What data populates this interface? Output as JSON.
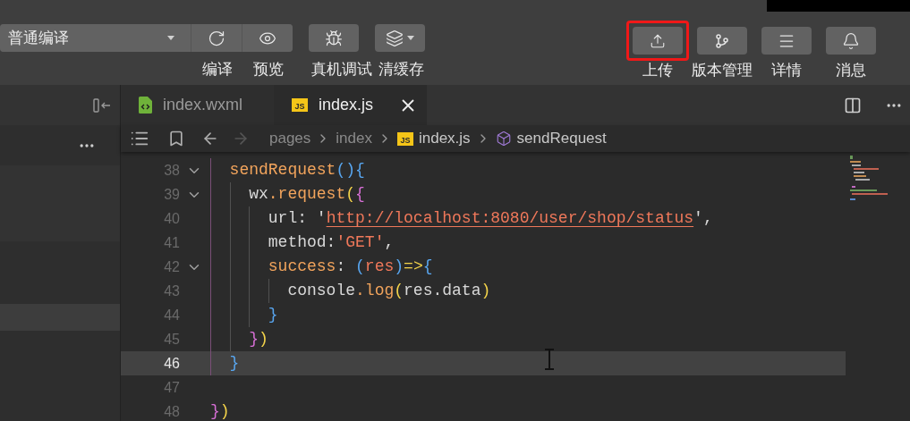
{
  "toolbar": {
    "compile_mode": {
      "value": "普通编译"
    },
    "left_buttons": [
      {
        "kind": "refresh",
        "label": "编译",
        "has_menu": false
      },
      {
        "kind": "eye",
        "label": "预览",
        "has_menu": false
      },
      {
        "kind": "bug",
        "label": "真机调试",
        "has_menu": false
      },
      {
        "kind": "layers",
        "label": "清缓存",
        "has_menu": true
      }
    ],
    "right_buttons": [
      {
        "kind": "upload",
        "label": "上传",
        "highlighted": true
      },
      {
        "kind": "branch",
        "label": "版本管理",
        "highlighted": false
      },
      {
        "kind": "menu",
        "label": "详情",
        "highlighted": false
      },
      {
        "kind": "bell",
        "label": "消息",
        "highlighted": false
      }
    ]
  },
  "editor_tabs": [
    {
      "label": "index.wxml",
      "kind": "wxml",
      "selected": false
    },
    {
      "label": "index.js",
      "kind": "js",
      "badge": "JS",
      "selected": true
    }
  ],
  "breadcrumb": [
    {
      "text": "pages",
      "kind": "folder"
    },
    {
      "text": "index",
      "kind": "folder"
    },
    {
      "text": "index.js",
      "kind": "js",
      "badge": "JS"
    },
    {
      "text": "sendRequest",
      "kind": "method"
    }
  ],
  "code_lines": [
    {
      "number": "38",
      "foldable": true,
      "current": false,
      "tokens": [
        {
          "text": "  sendRequest",
          "kind": "func"
        },
        {
          "text": "()",
          "kind": "b3"
        },
        {
          "text": "{",
          "kind": "b3"
        }
      ]
    },
    {
      "number": "39",
      "foldable": true,
      "current": false,
      "tokens": [
        {
          "text": "    wx",
          "kind": "text"
        },
        {
          "text": ".request",
          "kind": "func"
        },
        {
          "text": "(",
          "kind": "b1"
        },
        {
          "text": "{",
          "kind": "b2"
        }
      ]
    },
    {
      "number": "40",
      "foldable": false,
      "current": false,
      "tokens": [
        {
          "text": "      url: '",
          "kind": "text"
        },
        {
          "text": "http://localhost:8080/user/shop/status",
          "kind": "link"
        },
        {
          "text": "',",
          "kind": "text"
        }
      ]
    },
    {
      "number": "41",
      "foldable": false,
      "current": false,
      "tokens": [
        {
          "text": "      method:",
          "kind": "text"
        },
        {
          "text": "'GET'",
          "kind": "str"
        },
        {
          "text": ",",
          "kind": "text"
        }
      ]
    },
    {
      "number": "42",
      "foldable": true,
      "current": false,
      "tokens": [
        {
          "text": "      success",
          "kind": "func"
        },
        {
          "text": ": ",
          "kind": "text"
        },
        {
          "text": "(",
          "kind": "b3"
        },
        {
          "text": "res",
          "kind": "param"
        },
        {
          "text": ")",
          "kind": "b3"
        },
        {
          "text": "=>",
          "kind": "b1"
        },
        {
          "text": "{",
          "kind": "b3"
        }
      ]
    },
    {
      "number": "43",
      "foldable": false,
      "current": false,
      "tokens": [
        {
          "text": "        console",
          "kind": "text"
        },
        {
          "text": ".log",
          "kind": "func"
        },
        {
          "text": "(",
          "kind": "b1"
        },
        {
          "text": "res.data",
          "kind": "text"
        },
        {
          "text": ")",
          "kind": "b1"
        }
      ]
    },
    {
      "number": "44",
      "foldable": false,
      "current": false,
      "tokens": [
        {
          "text": "      }",
          "kind": "b3"
        }
      ]
    },
    {
      "number": "45",
      "foldable": false,
      "current": false,
      "tokens": [
        {
          "text": "    }",
          "kind": "b2"
        },
        {
          "text": ")",
          "kind": "b1"
        }
      ]
    },
    {
      "number": "46",
      "foldable": false,
      "current": true,
      "tokens": [
        {
          "text": "  }",
          "kind": "b3"
        }
      ]
    },
    {
      "number": "47",
      "foldable": false,
      "current": false
    },
    {
      "number": "48",
      "foldable": false,
      "current": false,
      "tokens": [
        {
          "text": "}",
          "kind": "b2"
        },
        {
          "text": ")",
          "kind": "b1"
        }
      ]
    }
  ]
}
